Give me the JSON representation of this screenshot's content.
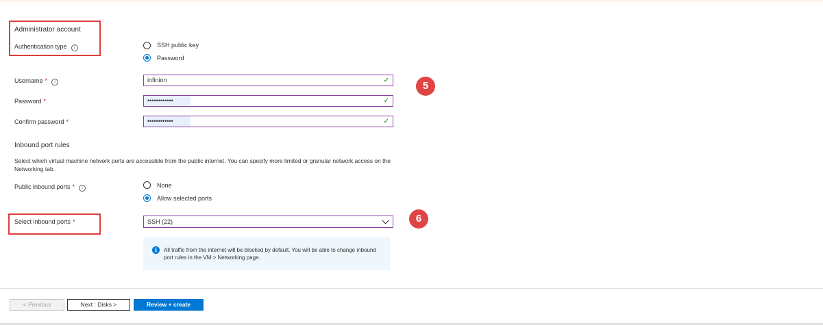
{
  "admin": {
    "heading": "Administrator account",
    "auth_label": "Authentication type",
    "auth_options": [
      "SSH public key",
      "Password"
    ],
    "auth_selected": "Password"
  },
  "fields": {
    "username_label": "Username",
    "username_value": "infinion",
    "password_label": "Password",
    "password_value": "••••••••••••",
    "confirm_label": "Confirm password",
    "confirm_value": "••••••••••••",
    "required_mark": "*"
  },
  "inbound": {
    "heading": "Inbound port rules",
    "description": "Select which virtual machine network ports are accessible from the public internet. You can specify more limited or granular network access on the Networking tab.",
    "public_label": "Public inbound ports",
    "public_options": [
      "None",
      "Allow selected ports"
    ],
    "public_selected": "Allow selected ports",
    "select_label": "Select inbound ports",
    "select_value": "SSH (22)",
    "info_text": "All traffic from the internet will be blocked by default. You will be able to change inbound port rules in the VM > Networking page."
  },
  "annotations": {
    "badge_5": "5",
    "badge_6": "6",
    "highlight_color": "#e03e3e"
  },
  "footer": {
    "prev_label": "< Previous",
    "next_label": "Next : Disks >",
    "review_label": "Review + create"
  },
  "colors": {
    "accent": "#0078d4",
    "input_border": "#8a3ea3",
    "valid_check": "#107c10"
  },
  "icons": {
    "info": "info-icon",
    "check": "checkmark-icon",
    "chevron": "chevron-down-icon"
  }
}
